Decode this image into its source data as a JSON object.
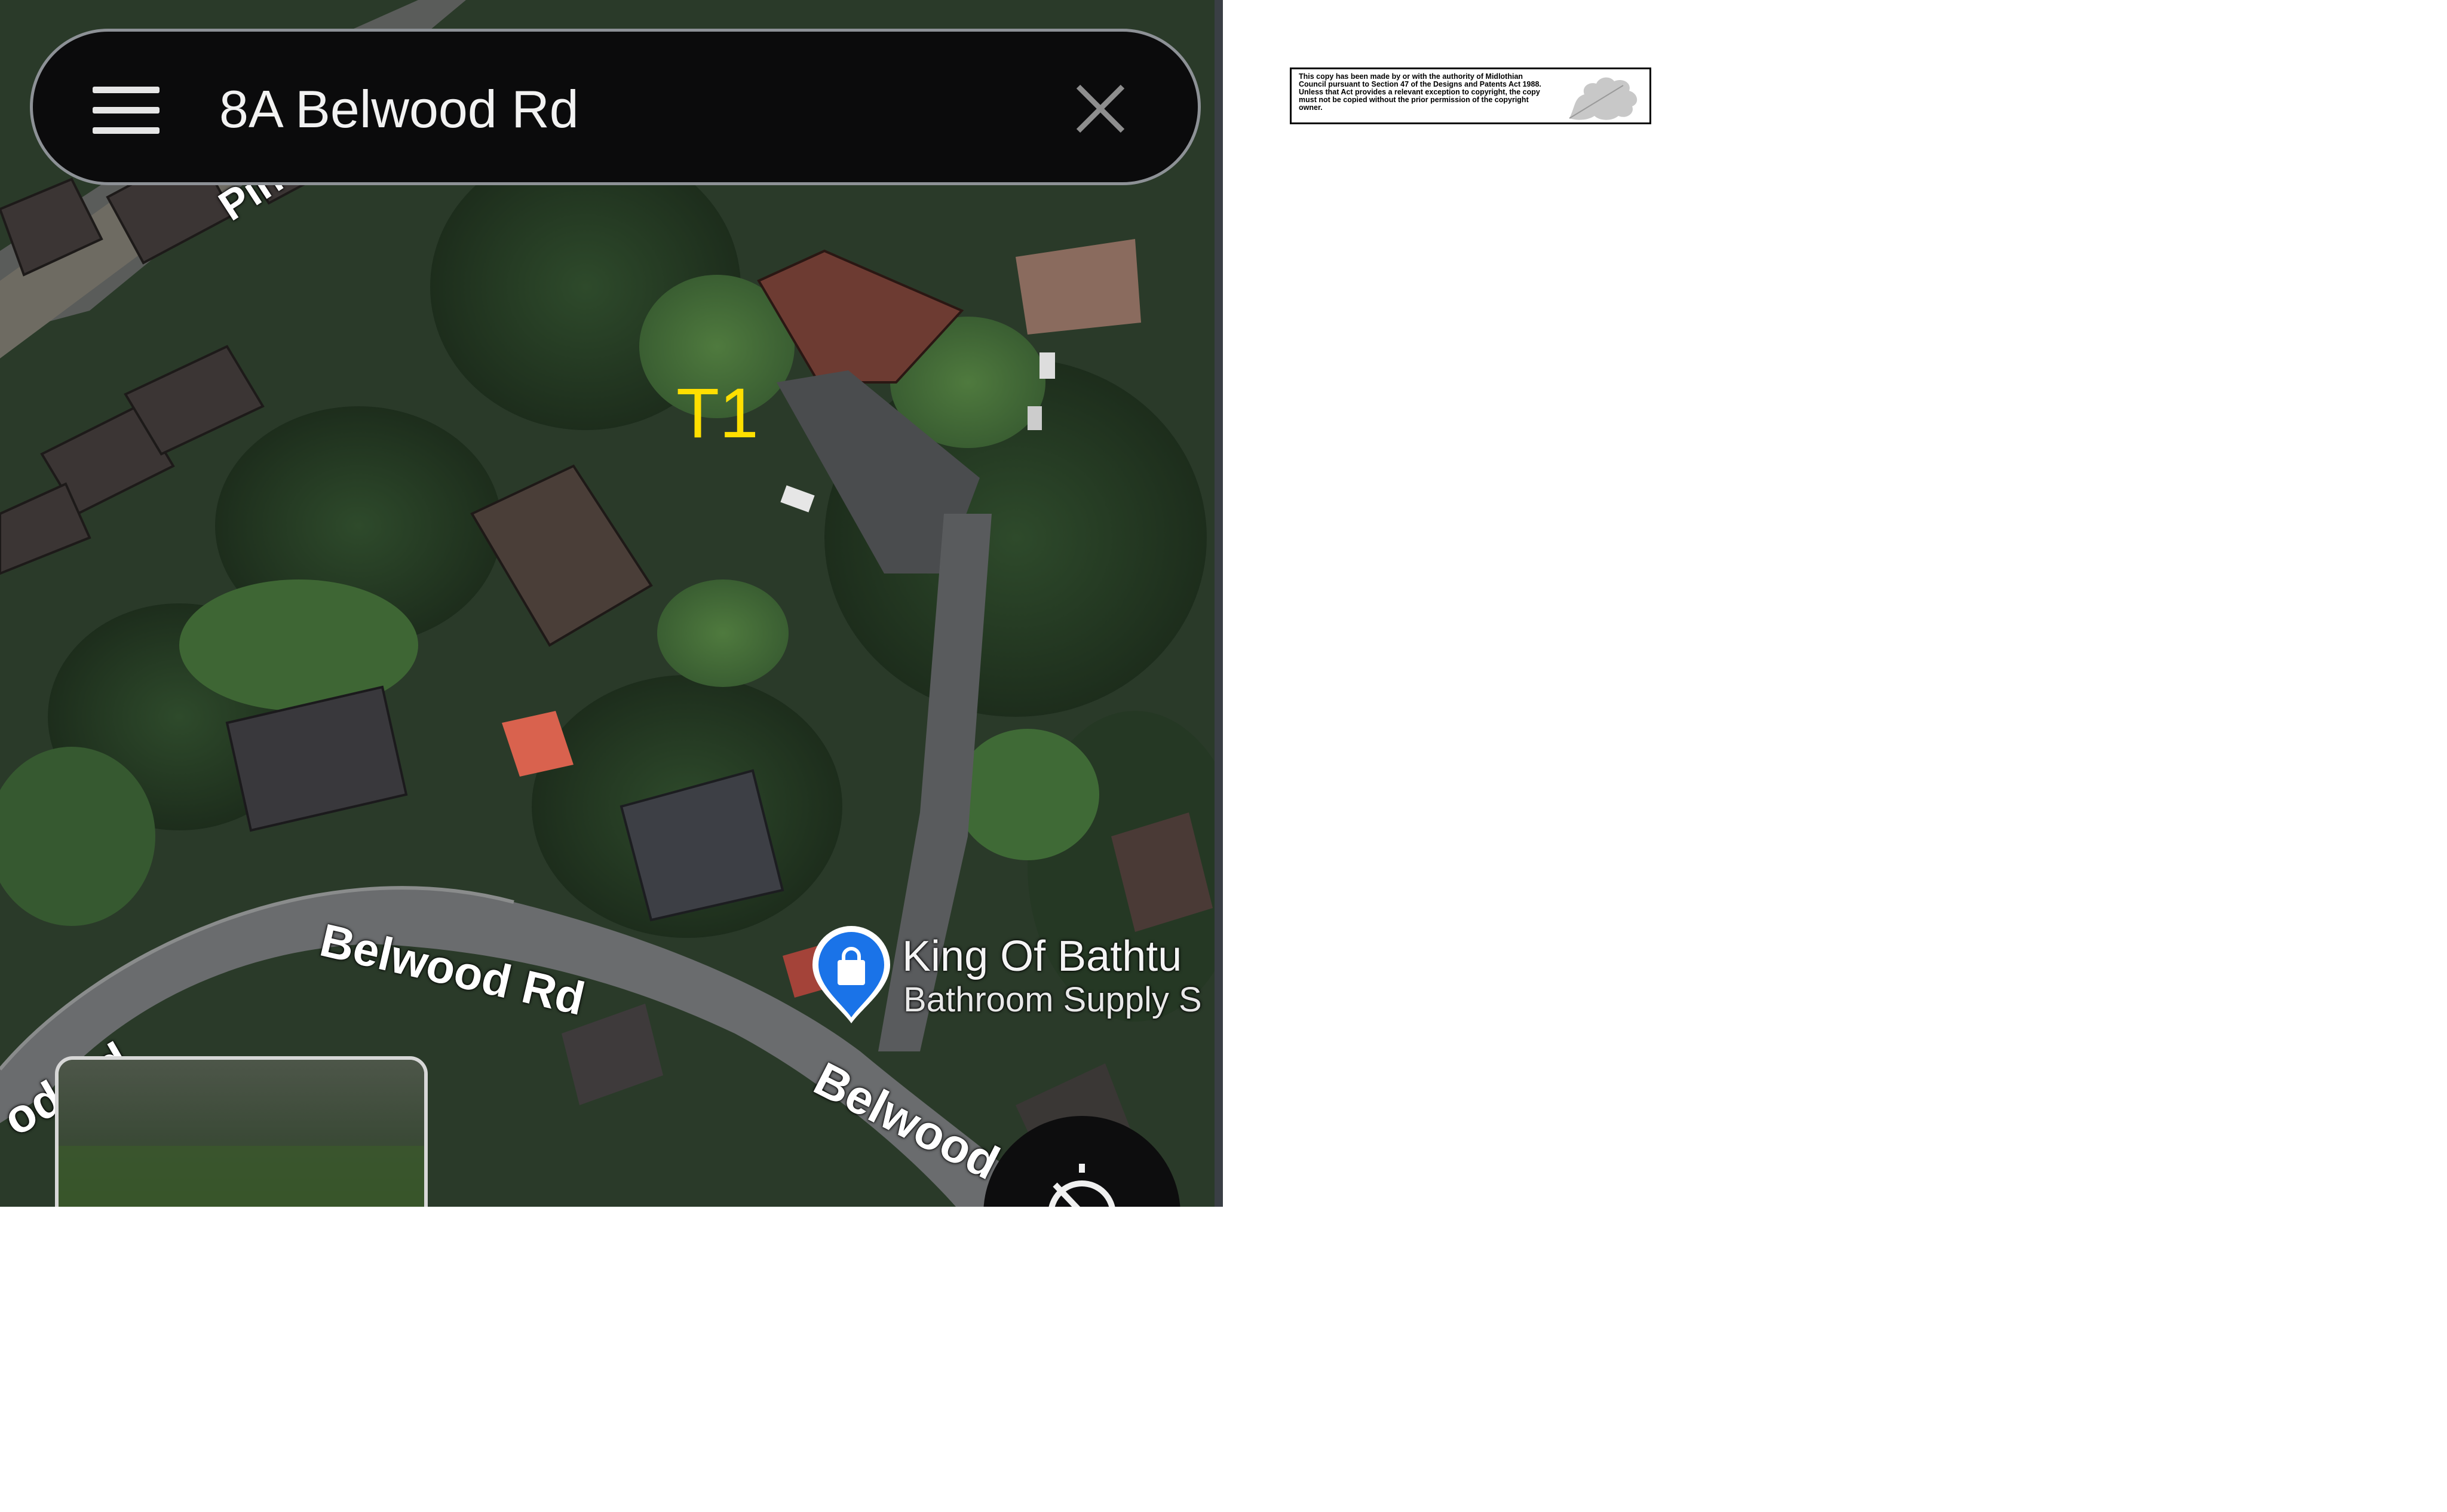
{
  "search": {
    "query": "8A Belwood Rd",
    "menu_icon": "hamburger-menu-icon",
    "close_icon": "close-icon"
  },
  "map": {
    "style": "satellite",
    "marker_label": "T1",
    "road_labels": [
      "Pine",
      "Belwood Rd",
      "Belwood",
      "od Rd"
    ],
    "poi": {
      "name": "King Of Bathtu",
      "category": "Bathroom Supply S",
      "icon": "shopping-bag-icon",
      "pin_color": "#1a73e8"
    },
    "compass_icon": "compass-icon",
    "marker_color": "#ffdf00"
  },
  "notice": {
    "text": "This copy has been made by or with the authority of Midlothian Council pursuant to Section 47 of the Designs and Patents Act 1988. Unless that Act provides a relevant exception to copyright, the copy must not be copied without the prior permission of the copyright owner.",
    "logo": "oak-leaf-logo"
  }
}
